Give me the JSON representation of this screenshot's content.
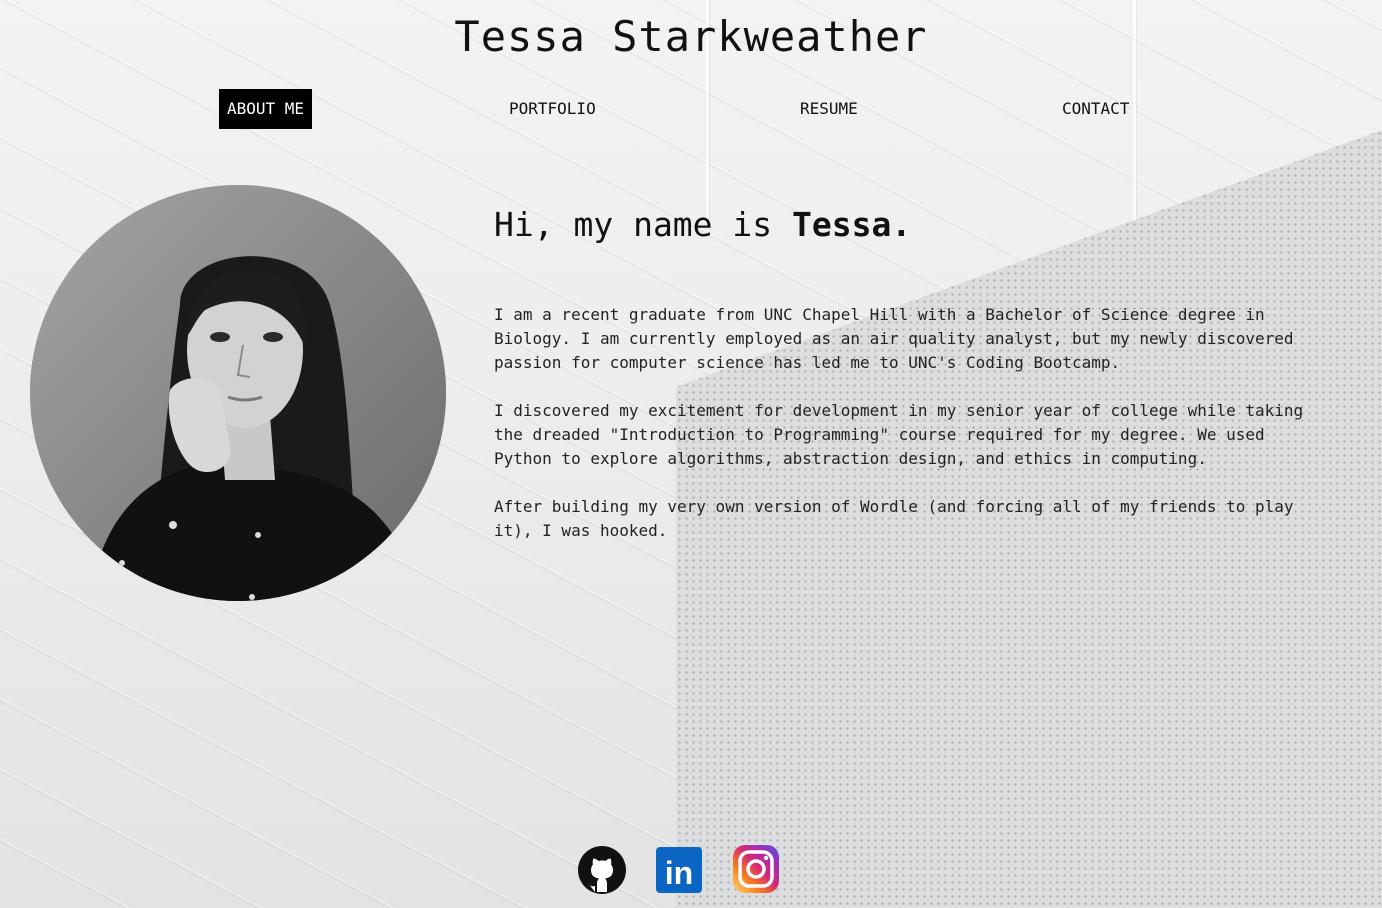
{
  "header": {
    "title": "Tessa Starkweather"
  },
  "nav": {
    "items": [
      {
        "label": "ABOUT ME",
        "active": true
      },
      {
        "label": "PORTFOLIO",
        "active": false
      },
      {
        "label": "RESUME",
        "active": false
      },
      {
        "label": "CONTACT",
        "active": false
      }
    ]
  },
  "about": {
    "greeting_prefix": "Hi, my name is ",
    "greeting_name": "Tessa.",
    "paragraphs": [
      "I am a recent graduate from UNC Chapel Hill with a Bachelor of Science degree in Biology. I am currently employed as an air quality analyst, but my newly discovered passion for computer science has led me to UNC's Coding Bootcamp.",
      "I discovered my excitement for development in my senior year of college while taking the dreaded \"Introduction to Programming\" course required for my degree. We used Python to explore algorithms, abstraction design, and ethics in computing.",
      "After building my very own version of Wordle (and forcing all of my friends to play it), I was hooked."
    ]
  },
  "socials": {
    "icons": [
      "github-icon",
      "linkedin-icon",
      "instagram-icon"
    ],
    "linkedin_text": "in"
  },
  "colors": {
    "text": "#111111",
    "nav_active_bg": "#000000",
    "nav_active_text": "#ffffff",
    "linkedin_blue": "#0a66c2"
  }
}
